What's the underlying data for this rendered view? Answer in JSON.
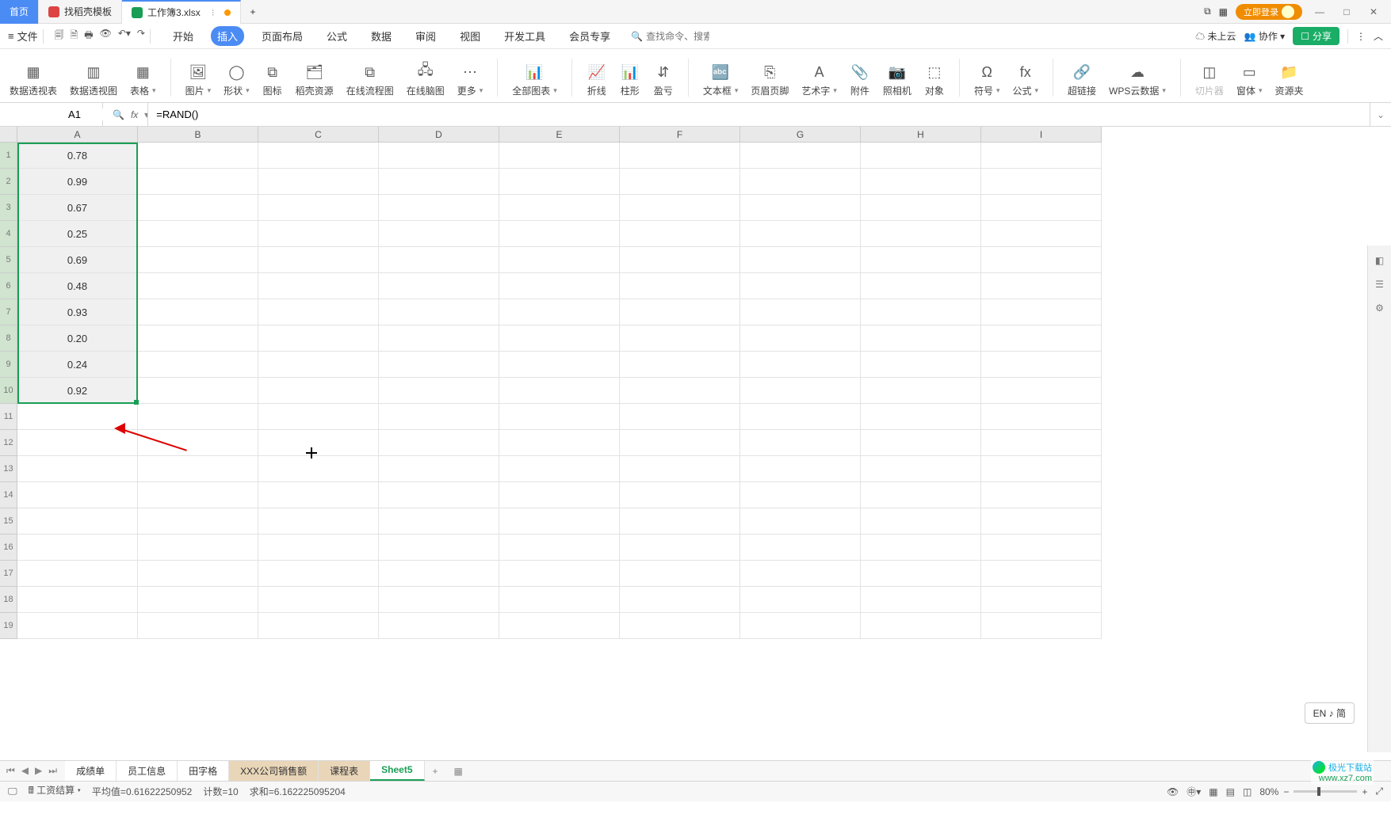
{
  "title_tabs": {
    "home": "首页",
    "t1": "找稻壳模板",
    "t2": "工作簿3.xlsx",
    "login": "立即登录"
  },
  "menu": {
    "file": "文件",
    "tabs": [
      "开始",
      "插入",
      "页面布局",
      "公式",
      "数据",
      "审阅",
      "视图",
      "开发工具",
      "会员专享"
    ],
    "active_idx": 1,
    "search_placeholder": "查找命令、搜索模板",
    "cloud": "未上云",
    "collab": "协作",
    "share": "分享"
  },
  "ribbon": [
    {
      "label": "数据透视表",
      "drop": false
    },
    {
      "label": "数据透视图",
      "drop": false
    },
    {
      "label": "表格",
      "drop": true
    },
    {
      "label": "图片",
      "drop": true
    },
    {
      "label": "形状",
      "drop": true
    },
    {
      "label": "图标",
      "drop": false
    },
    {
      "label": "稻壳资源",
      "drop": false
    },
    {
      "label": "在线流程图",
      "drop": false
    },
    {
      "label": "在线脑图",
      "drop": false
    },
    {
      "label": "更多",
      "drop": true
    },
    {
      "label": "全部图表",
      "drop": true
    },
    {
      "label": "折线",
      "drop": false
    },
    {
      "label": "柱形",
      "drop": false
    },
    {
      "label": "盈亏",
      "drop": false
    },
    {
      "label": "文本框",
      "drop": true
    },
    {
      "label": "页眉页脚",
      "drop": false
    },
    {
      "label": "艺术字",
      "drop": true
    },
    {
      "label": "附件",
      "drop": false
    },
    {
      "label": "照相机",
      "drop": false
    },
    {
      "label": "对象",
      "drop": false
    },
    {
      "label": "符号",
      "drop": true
    },
    {
      "label": "公式",
      "drop": true
    },
    {
      "label": "超链接",
      "drop": false
    },
    {
      "label": "WPS云数据",
      "drop": true
    },
    {
      "label": "切片器",
      "drop": false,
      "disabled": true
    },
    {
      "label": "窗体",
      "drop": true
    },
    {
      "label": "资源夹",
      "drop": false
    }
  ],
  "namebox": "A1",
  "formula": "=RAND()",
  "columns": [
    "A",
    "B",
    "C",
    "D",
    "E",
    "F",
    "G",
    "H",
    "I"
  ],
  "row_count": 19,
  "cells_A": [
    "0.78",
    "0.99",
    "0.67",
    "0.25",
    "0.69",
    "0.48",
    "0.93",
    "0.20",
    "0.24",
    "0.92"
  ],
  "ime": "EN ♪ 简",
  "sheets": {
    "tabs": [
      "成绩单",
      "员工信息",
      "田字格",
      "XXX公司销售额",
      "课程表",
      "Sheet5"
    ],
    "highlighted": [
      3,
      4
    ],
    "current": 5
  },
  "status": {
    "calc_name": "工资结算",
    "avg_label": "平均值=",
    "avg": "0.61622250952",
    "count_label": "计数=",
    "count": "10",
    "sum_label": "求和=",
    "sum": "6.162225095204",
    "zoom": "80%"
  },
  "watermark": {
    "name": "极光下载站",
    "url": "www.xz7.com"
  }
}
